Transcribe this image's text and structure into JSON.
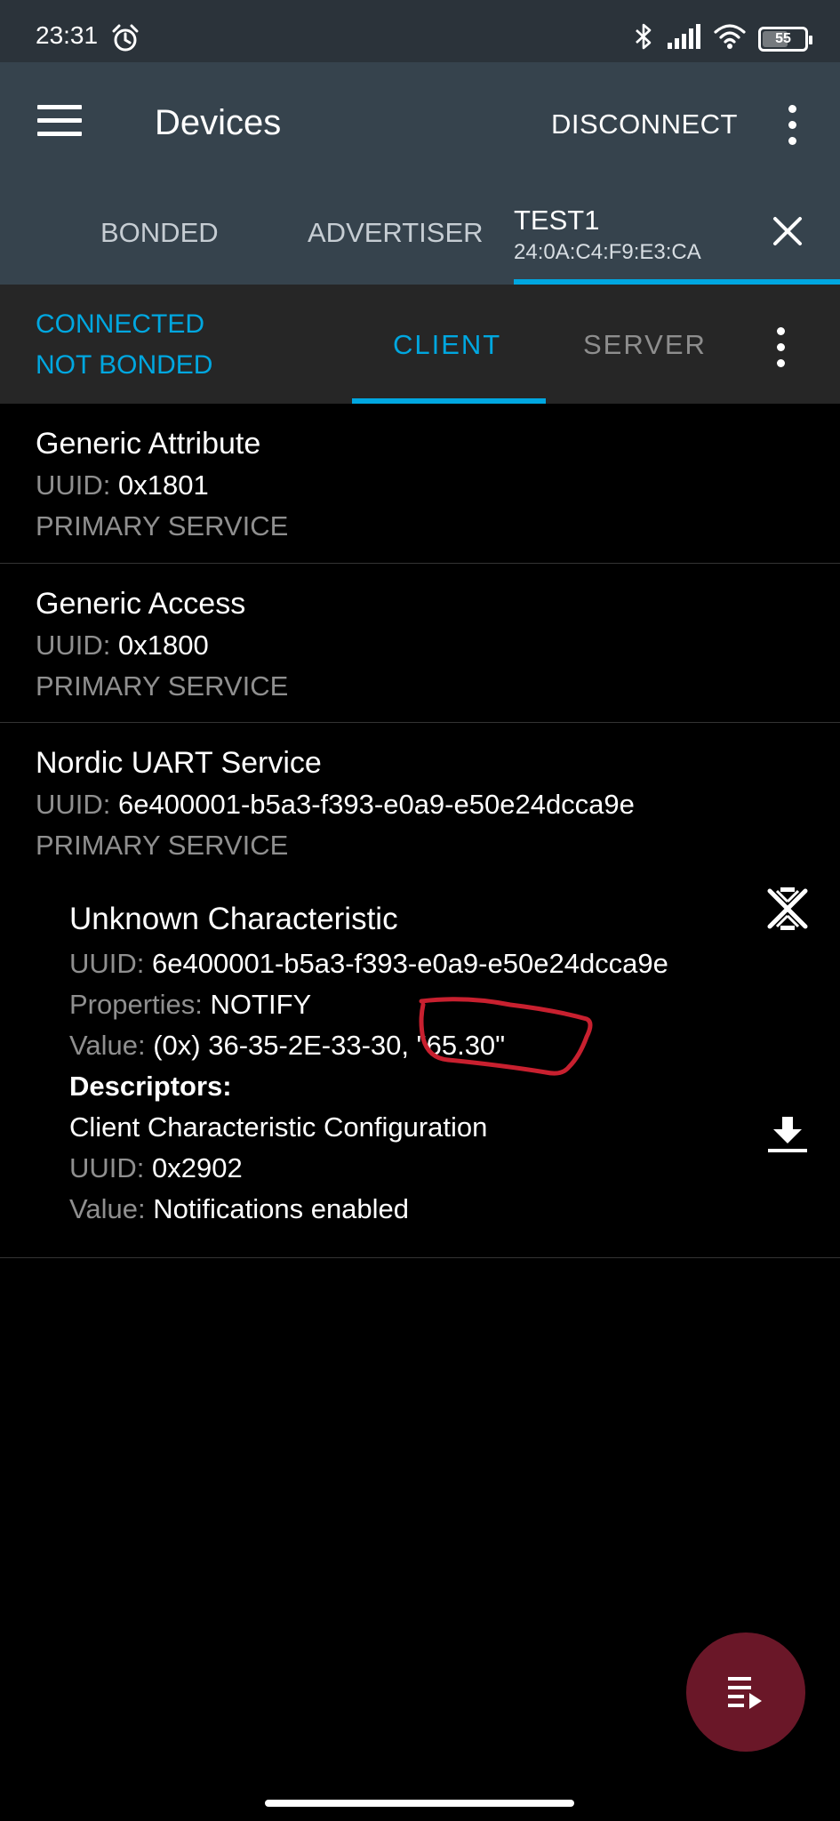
{
  "status_bar": {
    "time": "23:31",
    "battery_level": "55",
    "icons": [
      "alarm-icon",
      "bluetooth-icon",
      "signal-icon",
      "wifi-icon",
      "battery-icon"
    ]
  },
  "app_bar": {
    "title": "Devices",
    "disconnect_label": "DISCONNECT",
    "tabs": [
      {
        "label": "BONDED"
      },
      {
        "label": "ADVERTISER"
      },
      {
        "label": "TEST1",
        "address": "24:0A:C4:F9:E3:CA",
        "selected": true
      }
    ]
  },
  "connection": {
    "status": "CONNECTED",
    "bond": "NOT BONDED",
    "tabs": [
      {
        "label": "CLIENT",
        "selected": true
      },
      {
        "label": "SERVER"
      }
    ]
  },
  "labels": {
    "uuid": "UUID:",
    "properties": "Properties:",
    "value": "Value:",
    "descriptors": "Descriptors:"
  },
  "services": [
    {
      "name": "Generic Attribute",
      "uuid": "0x1801",
      "type": "PRIMARY SERVICE"
    },
    {
      "name": "Generic Access",
      "uuid": "0x1800",
      "type": "PRIMARY SERVICE"
    },
    {
      "name": "Nordic UART Service",
      "uuid": "6e400001-b5a3-f393-e0a9-e50e24dcca9e",
      "type": "PRIMARY SERVICE"
    }
  ],
  "characteristic": {
    "name": "Unknown Characteristic",
    "uuid": "6e400001-b5a3-f393-e0a9-e50e24dcca9e",
    "properties": "NOTIFY",
    "value": "(0x) 36-35-2E-33-30, \"65.30\"",
    "descriptor": {
      "name": "Client Characteristic Configuration",
      "uuid": "0x2902",
      "value": "Notifications enabled"
    }
  },
  "colors": {
    "accent": "#00a7e0",
    "app_bar": "#36434d",
    "status_bar": "#2b333a",
    "connection_bar": "#262626",
    "fab": "#6a1728",
    "annotation": "#c8202f"
  }
}
